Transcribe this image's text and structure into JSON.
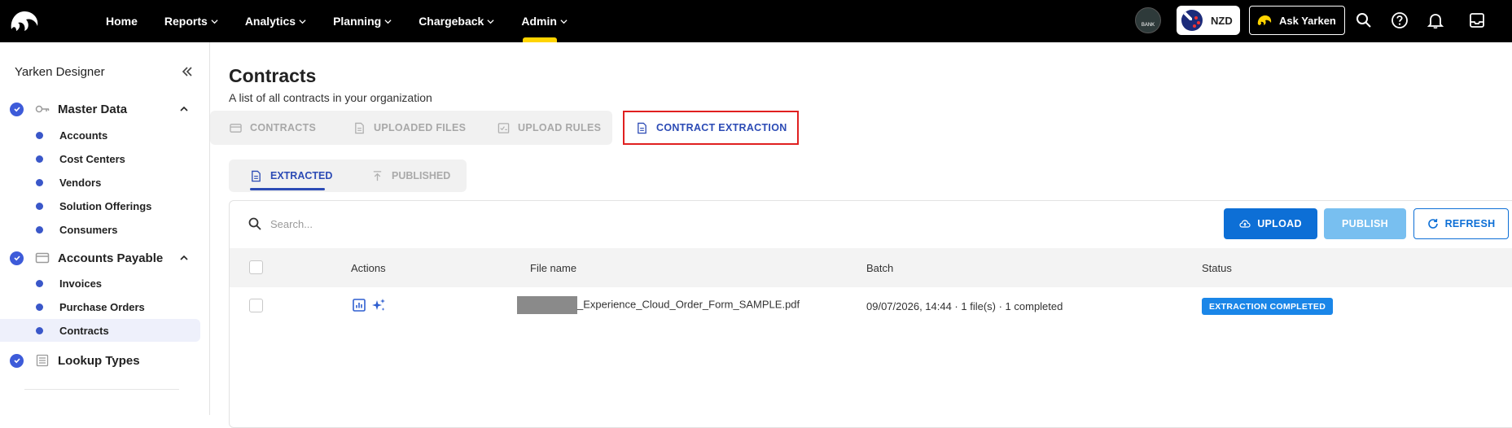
{
  "nav": {
    "items": [
      {
        "label": "Home",
        "dropdown": false
      },
      {
        "label": "Reports",
        "dropdown": true
      },
      {
        "label": "Analytics",
        "dropdown": true
      },
      {
        "label": "Planning",
        "dropdown": true
      },
      {
        "label": "Chargeback",
        "dropdown": true
      },
      {
        "label": "Admin",
        "dropdown": true
      }
    ],
    "active": "Admin",
    "bank_label": "BANK",
    "currency": "NZD",
    "ask_label": "Ask Yarken"
  },
  "sidebar": {
    "title": "Yarken Designer",
    "groups": [
      {
        "label": "Master Data",
        "icon": "key-icon",
        "items": [
          "Accounts",
          "Cost Centers",
          "Vendors",
          "Solution Offerings",
          "Consumers"
        ]
      },
      {
        "label": "Accounts Payable",
        "icon": "card-icon",
        "items": [
          "Invoices",
          "Purchase Orders",
          "Contracts"
        ]
      },
      {
        "label": "Lookup Types",
        "icon": "list-icon",
        "items": []
      }
    ],
    "active_item": "Contracts"
  },
  "page": {
    "title": "Contracts",
    "subtitle": "A list of all contracts in your organization"
  },
  "tabs": [
    {
      "label": "CONTRACTS",
      "icon": "card-icon"
    },
    {
      "label": "UPLOADED FILES",
      "icon": "file-icon"
    },
    {
      "label": "UPLOAD RULES",
      "icon": "rules-icon"
    },
    {
      "label": "CONTRACT EXTRACTION",
      "icon": "document-icon"
    }
  ],
  "active_tab": "CONTRACT EXTRACTION",
  "subtabs": [
    {
      "label": "EXTRACTED",
      "icon": "document-icon"
    },
    {
      "label": "PUBLISHED",
      "icon": "upload-arrow-icon"
    }
  ],
  "active_subtab": "EXTRACTED",
  "toolbar": {
    "search_placeholder": "Search...",
    "upload_label": "UPLOAD",
    "publish_label": "PUBLISH",
    "refresh_label": "REFRESH"
  },
  "table": {
    "columns": [
      "Actions",
      "File name",
      "Batch",
      "Status"
    ],
    "rows": [
      {
        "file_name_suffix": "_Experience_Cloud_Order_Form_SAMPLE.pdf",
        "batch": "09/07/2026, 14:44 · 1 file(s) · 1 completed",
        "status": "EXTRACTION COMPLETED"
      }
    ]
  },
  "colors": {
    "primary": "#0d6fd6",
    "accent_yellow": "#ffd400",
    "active_tab_text": "#2c4bb5",
    "highlight_border": "#e02020",
    "status_badge": "#1a86e8"
  }
}
